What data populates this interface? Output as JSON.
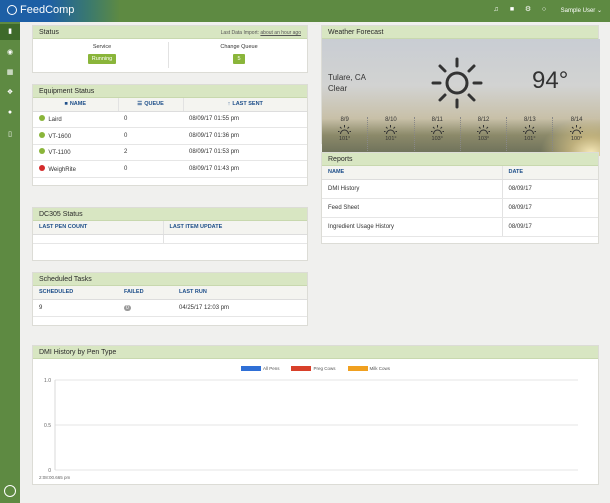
{
  "app": {
    "brand": "FeedComp",
    "user": "Sample User"
  },
  "topbar": {
    "icons": [
      "bell-icon",
      "truck-icon",
      "gear-icon",
      "chat-icon"
    ]
  },
  "status": {
    "title": "Status",
    "last_import_label": "Last Data Import:",
    "last_import_value": "about an hour ago",
    "service_label": "Service",
    "service_value": "Running",
    "queue_label": "Change Queue",
    "queue_value": "5"
  },
  "equipment": {
    "title": "Equipment Status",
    "headers": [
      "NAME",
      "QUEUE",
      "LAST SENT"
    ],
    "rows": [
      {
        "name": "Laird",
        "queue": "0",
        "last_sent": "08/09/17 01:55 pm",
        "status_color": "#8ab53a"
      },
      {
        "name": "VT-1600",
        "queue": "0",
        "last_sent": "08/09/17 01:36 pm",
        "status_color": "#8ab53a"
      },
      {
        "name": "VT-1100",
        "queue": "2",
        "last_sent": "08/09/17 01:53 pm",
        "status_color": "#8ab53a"
      },
      {
        "name": "WeighRite",
        "queue": "0",
        "last_sent": "08/09/17 01:43 pm",
        "status_color": "#d42a2a"
      }
    ]
  },
  "dc305": {
    "title": "DC305 Status",
    "headers": [
      "LAST PEN COUNT",
      "LAST ITEM UPDATE"
    ]
  },
  "tasks": {
    "title": "Scheduled Tasks",
    "headers": [
      "SCHEDULED",
      "FAILED",
      "LAST RUN"
    ],
    "rows": [
      {
        "scheduled": "9",
        "failed": "0",
        "last_run": "04/25/17 12:03 pm"
      }
    ]
  },
  "weather": {
    "title": "Weather Forecast",
    "city": "Tulare, CA",
    "condition": "Clear",
    "temp": "94°",
    "days": [
      {
        "date": "8/9",
        "temp": "101°"
      },
      {
        "date": "8/10",
        "temp": "101°"
      },
      {
        "date": "8/11",
        "temp": "103°"
      },
      {
        "date": "8/12",
        "temp": "103°"
      },
      {
        "date": "8/13",
        "temp": "101°"
      },
      {
        "date": "8/14",
        "temp": "100°"
      }
    ]
  },
  "reports": {
    "title": "Reports",
    "headers": [
      "NAME",
      "DATE"
    ],
    "rows": [
      {
        "name": "DMI History",
        "date": "08/09/17"
      },
      {
        "name": "Feed Sheet",
        "date": "08/09/17"
      },
      {
        "name": "Ingredient Usage History",
        "date": "08/09/17"
      }
    ]
  },
  "dmi": {
    "title": "DMI History by Pen Type",
    "legend": [
      {
        "name": "All Pens",
        "color": "#2f6fd6"
      },
      {
        "name": "Preg Cows",
        "color": "#d8402a"
      },
      {
        "name": "Milk Cows",
        "color": "#f0a020"
      }
    ]
  },
  "chart_data": {
    "type": "line",
    "title": "DMI History by Pen Type",
    "x": [
      "2:08:00.665 pm"
    ],
    "series": [
      {
        "name": "All Pens",
        "values": []
      },
      {
        "name": "Preg Cows",
        "values": []
      },
      {
        "name": "Milk Cows",
        "values": []
      }
    ],
    "y_ticks": [
      "1.0",
      "0.5",
      "0"
    ],
    "ylim": [
      0,
      1.0
    ],
    "grid": true,
    "legend_position": "top-center"
  }
}
